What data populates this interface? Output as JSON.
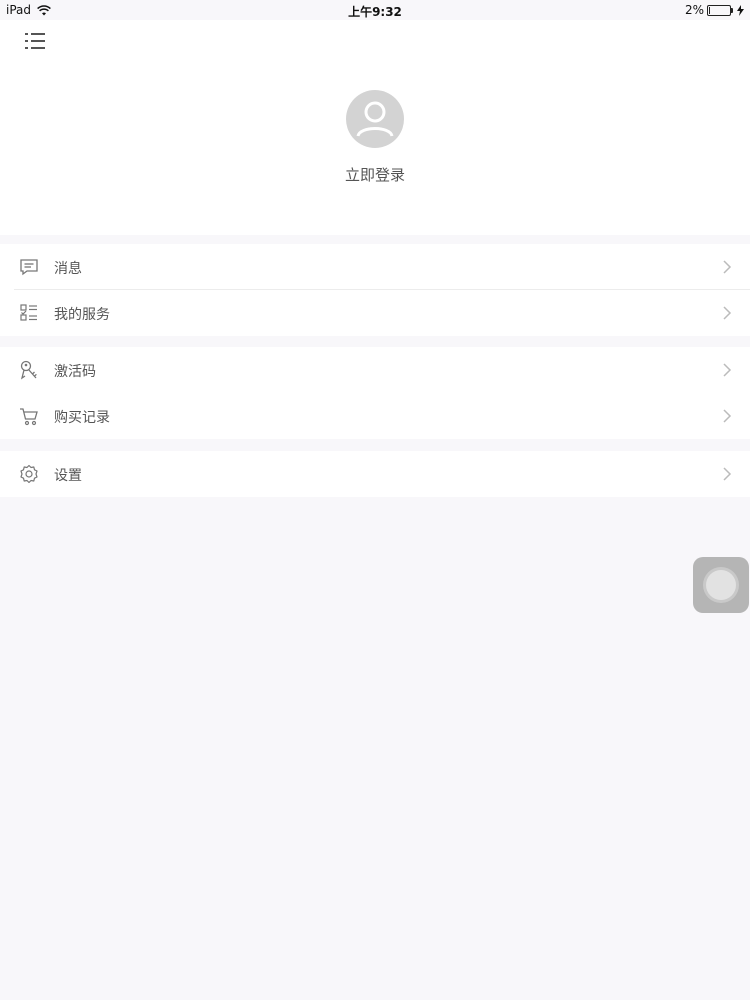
{
  "status_bar": {
    "device": "iPad",
    "time": "上午9:32",
    "battery": "2%"
  },
  "header": {
    "login_label": "立即登录"
  },
  "menu_groups": [
    [
      {
        "label": "消息",
        "icon": "message-icon"
      },
      {
        "label": "我的服务",
        "icon": "checklist-icon"
      }
    ],
    [
      {
        "label": "激活码",
        "icon": "key-icon"
      },
      {
        "label": "购买记录",
        "icon": "cart-icon"
      }
    ],
    [
      {
        "label": "设置",
        "icon": "gear-icon"
      }
    ]
  ],
  "colors": {
    "background": "#f8f7fa",
    "avatar": "#d3d3d3",
    "text": "#555555"
  }
}
